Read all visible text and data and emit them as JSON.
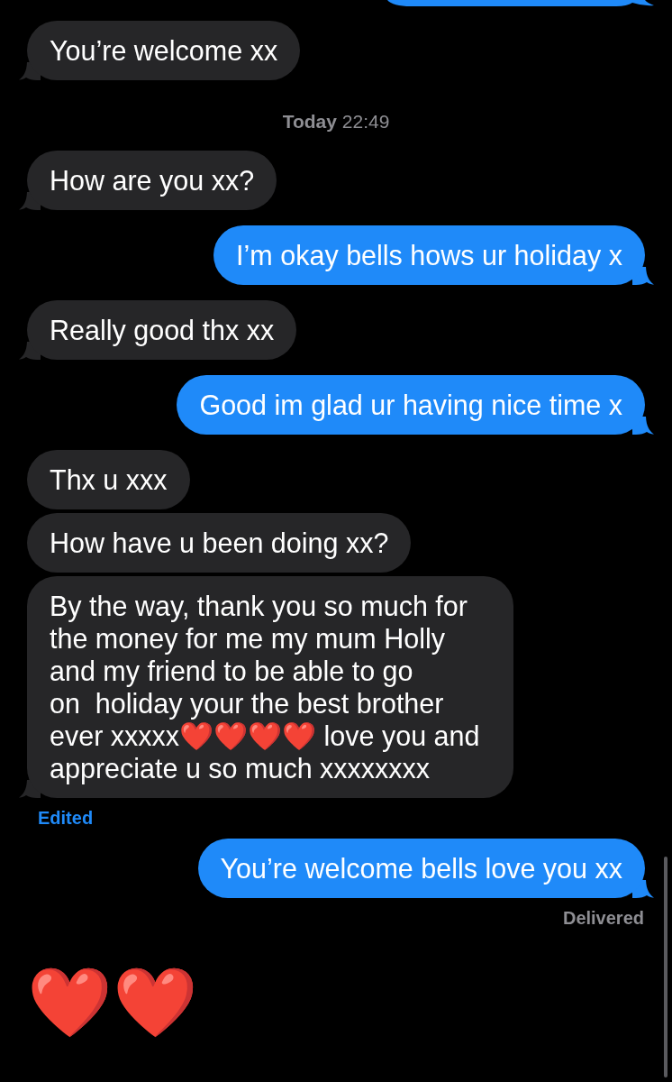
{
  "thread": [
    {
      "kind": "partial_bubble",
      "outgoing": true
    },
    {
      "kind": "bubble",
      "outgoing": false,
      "text": "You’re welcome xx",
      "tail": true
    },
    {
      "kind": "timestamp",
      "text": "**Today** 22:49"
    },
    {
      "kind": "bubble",
      "outgoing": false,
      "text": "How are you xx?",
      "tail": true
    },
    {
      "kind": "bubble",
      "outgoing": true,
      "text": "I’m okay bells hows ur holiday x",
      "tail": true
    },
    {
      "kind": "bubble",
      "outgoing": false,
      "text": "Really good thx xx",
      "tail": true
    },
    {
      "kind": "bubble",
      "outgoing": true,
      "text": "Good im glad ur having nice time x",
      "tail": true
    },
    {
      "kind": "bubble",
      "outgoing": false,
      "text": "Thx u xxx",
      "tail": false
    },
    {
      "kind": "bubble",
      "outgoing": false,
      "text": "How have u been doing xx?",
      "tail": false
    },
    {
      "kind": "bubble",
      "outgoing": false,
      "text": "By the way, thank you so much for the money for me my mum Holly and my friend to be able to go\non  holiday your the best brother ever xxxxx❤️❤️❤️❤️ love you and appreciate u so much xxxxxxxx",
      "tail": true,
      "edited_label": "Edited"
    },
    {
      "kind": "bubble",
      "outgoing": true,
      "text": "You’re welcome bells love you xx",
      "tail": true,
      "status": "Delivered"
    },
    {
      "kind": "emoji",
      "text": "❤️❤️"
    }
  ]
}
